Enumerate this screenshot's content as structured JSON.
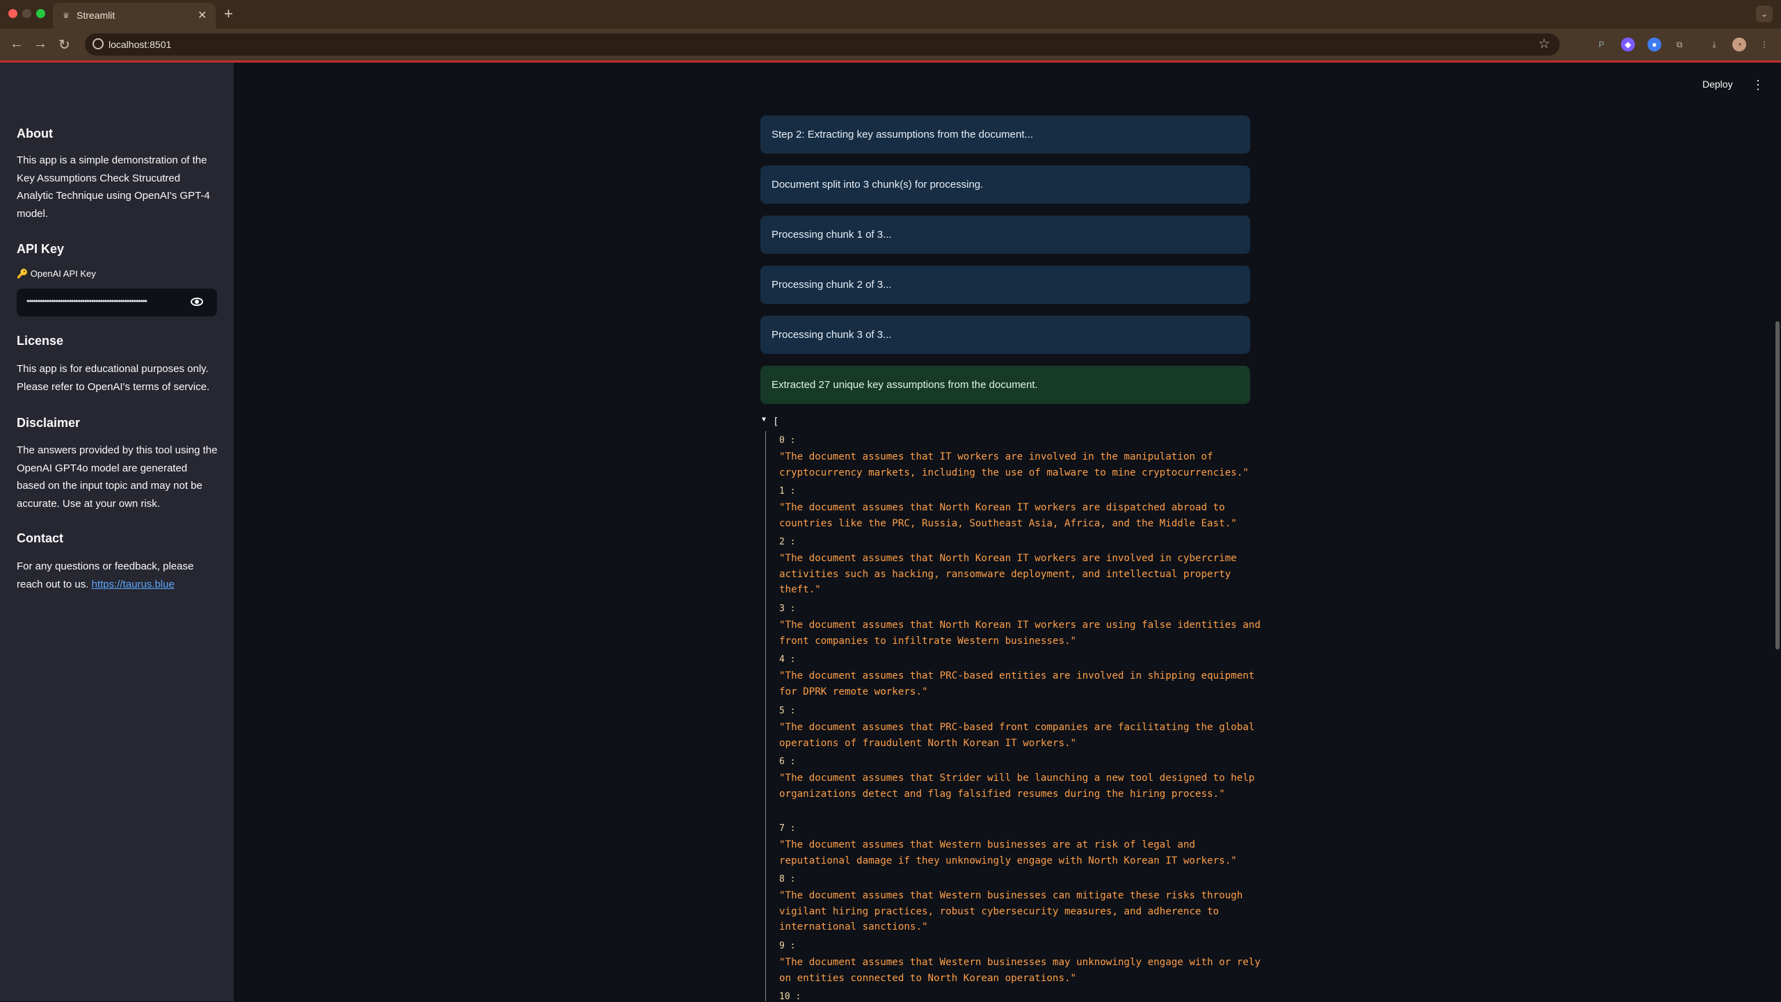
{
  "browser": {
    "tab_title": "Streamlit",
    "url": "localhost:8501"
  },
  "sidebar": {
    "about_heading": "About",
    "about_text": "This app is a simple demonstration of the Key Assumptions Check Strucutred Analytic Technique using OpenAI's GPT-4 model.",
    "api_heading": "API Key",
    "api_label": "🔑 OpenAI API Key",
    "api_value": "••••••••••••••••••••••••••••••••••••••••••••••••••••••",
    "license_heading": "License",
    "license_text": "This app is for educational purposes only. Please refer to OpenAI's terms of service.",
    "disclaimer_heading": "Disclaimer",
    "disclaimer_text": "The answers provided by this tool using the OpenAI GPT4o model are generated based on the input topic and may not be accurate. Use at your own risk.",
    "contact_heading": "Contact",
    "contact_text": "For any questions or feedback, please reach out to us.",
    "contact_link": "https://taurus.blue"
  },
  "header": {
    "deploy_label": "Deploy",
    "menu_icon": "kebab-icon"
  },
  "messages": [
    {
      "text": "Step 2: Extracting key assumptions from the document...",
      "kind": "info"
    },
    {
      "text": "Document split into 3 chunk(s) for processing.",
      "kind": "info"
    },
    {
      "text": "Processing chunk 1 of 3...",
      "kind": "info"
    },
    {
      "text": "Processing chunk 2 of 3...",
      "kind": "info"
    },
    {
      "text": "Processing chunk 3 of 3...",
      "kind": "info"
    },
    {
      "text": "Extracted 27 unique key assumptions from the document.",
      "kind": "success"
    }
  ],
  "json_view": {
    "open_bracket": "[",
    "items": [
      {
        "index": "0 :",
        "text": "\"The document assumes that IT workers are involved in the manipulation of cryptocurrency markets, including the use of malware to mine cryptocurrencies.\""
      },
      {
        "index": "1 :",
        "text": "\"The document assumes that North Korean IT workers are dispatched abroad to countries like the PRC, Russia, Southeast Asia, Africa, and the Middle East.\""
      },
      {
        "index": "2 :",
        "text": "\"The document assumes that North Korean IT workers are involved in cybercrime activities such as hacking, ransomware deployment, and intellectual property theft.\""
      },
      {
        "index": "3 :",
        "text": "\"The document assumes that North Korean IT workers are using false identities and front companies to infiltrate Western businesses.\""
      },
      {
        "index": "4 :",
        "text": "\"The document assumes that PRC-based entities are involved in shipping equipment for DPRK remote workers.\""
      },
      {
        "index": "5 :",
        "text": "\"The document assumes that PRC-based front companies are facilitating the global operations of fraudulent North Korean IT workers.\""
      },
      {
        "index": "6 :",
        "text": "\"The document assumes that Strider will be launching a new tool designed to help organizations detect and flag falsified resumes during the hiring process.\""
      },
      {
        "index": "7 :",
        "text": "\"The document assumes that Western businesses are at risk of legal and reputational damage if they unknowingly engage with North Korean IT workers.\""
      },
      {
        "index": "8 :",
        "text": "\"The document assumes that Western businesses can mitigate these risks through vigilant hiring practices, robust cybersecurity measures, and adherence to international sanctions.\""
      },
      {
        "index": "9 :",
        "text": "\"The document assumes that Western businesses may unknowingly engage with or rely on entities connected to North Korean operations.\""
      },
      {
        "index": "10 :",
        "text": ""
      }
    ]
  },
  "colors": {
    "app_bg": "#0e1117",
    "sidebar_bg": "#262730",
    "info_bg": "#172d43",
    "success_bg": "#173928",
    "json_string": "#ff9f4a",
    "link": "#5ea7ff"
  }
}
